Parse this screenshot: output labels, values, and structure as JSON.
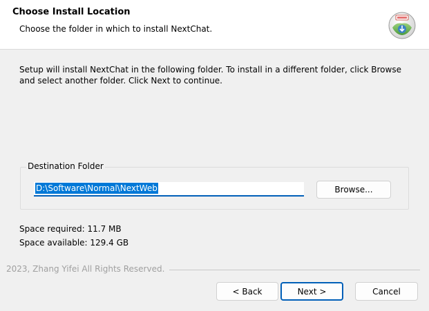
{
  "header": {
    "title": "Choose Install Location",
    "subtitle": "Choose the folder in which to install NextChat."
  },
  "main": {
    "instruction": "Setup will install NextChat in the following folder. To install in a different folder, click Browse and select another folder. Click Next to continue.",
    "destination_group_label": "Destination Folder",
    "destination_path": "D:\\Software\\Normal\\NextWeb",
    "browse_label": "Browse...",
    "space_required": "Space required: 11.7 MB",
    "space_available": "Space available: 129.4 GB"
  },
  "footer": {
    "branding": "2023, Zhang Yifei All Rights Reserved.",
    "back_label": "< Back",
    "next_label": "Next >",
    "cancel_label": "Cancel"
  },
  "colors": {
    "accent": "#005fb8",
    "selection": "#0078d7",
    "panel_background": "#f0f0f0"
  },
  "icons": {
    "header_icon": "installer-globe-icon"
  }
}
